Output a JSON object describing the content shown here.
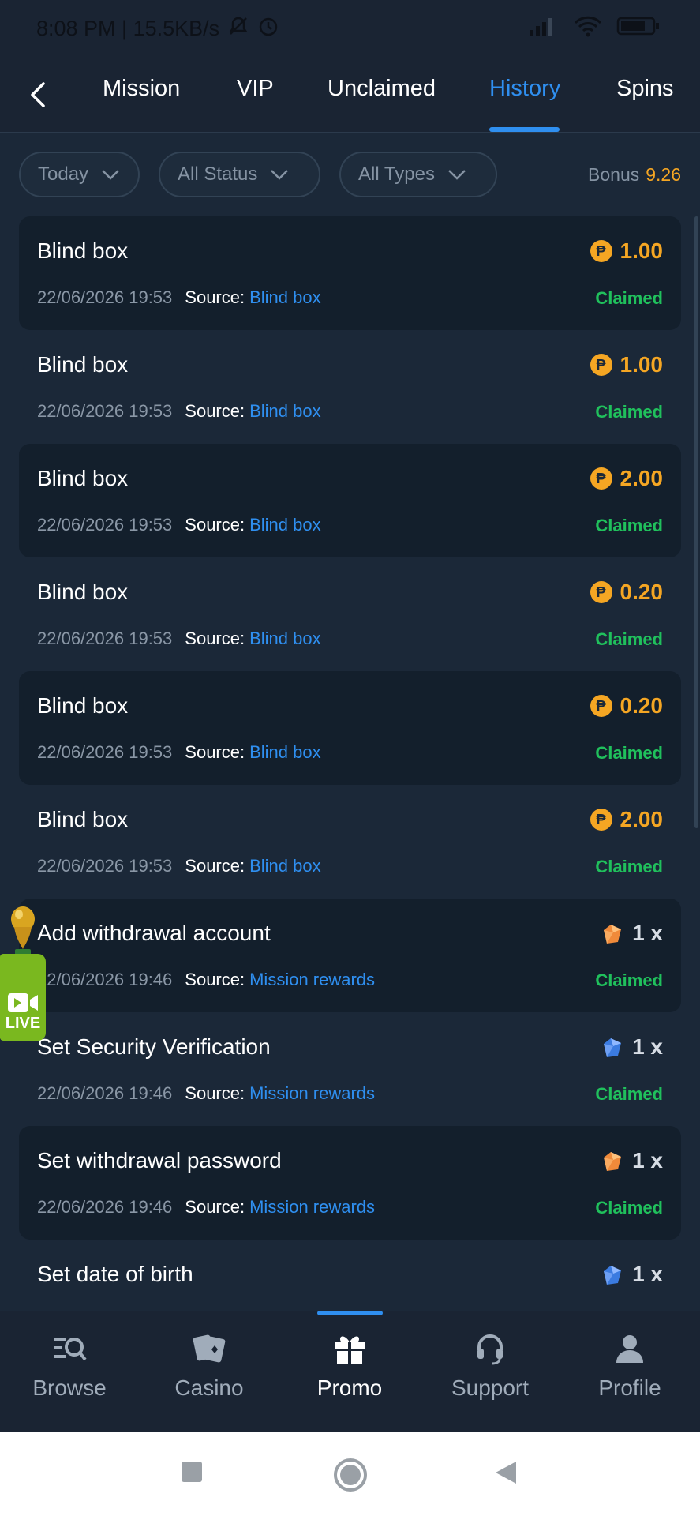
{
  "status_bar": {
    "time_speed": "8:08 PM | 15.5KB/s"
  },
  "tabs": [
    {
      "label": "Mission"
    },
    {
      "label": "VIP"
    },
    {
      "label": "Unclaimed"
    },
    {
      "label": "History",
      "active": true
    },
    {
      "label": "Spins"
    }
  ],
  "filters": {
    "date": "Today",
    "status": "All Status",
    "types": "All Types",
    "bonus_label": "Bonus",
    "bonus_value": "9.26"
  },
  "rows": [
    {
      "title": "Blind box",
      "date": "22/06/2026 19:53",
      "source_label": "Source:",
      "source": "Blind box",
      "amount": "1.00",
      "reward_icon": "coin-icon",
      "status": "Claimed"
    },
    {
      "title": "Blind box",
      "date": "22/06/2026 19:53",
      "source_label": "Source:",
      "source": "Blind box",
      "amount": "1.00",
      "reward_icon": "coin-icon",
      "status": "Claimed"
    },
    {
      "title": "Blind box",
      "date": "22/06/2026 19:53",
      "source_label": "Source:",
      "source": "Blind box",
      "amount": "2.00",
      "reward_icon": "coin-icon",
      "status": "Claimed"
    },
    {
      "title": "Blind box",
      "date": "22/06/2026 19:53",
      "source_label": "Source:",
      "source": "Blind box",
      "amount": "0.20",
      "reward_icon": "coin-icon",
      "status": "Claimed"
    },
    {
      "title": "Blind box",
      "date": "22/06/2026 19:53",
      "source_label": "Source:",
      "source": "Blind box",
      "amount": "0.20",
      "reward_icon": "coin-icon",
      "status": "Claimed"
    },
    {
      "title": "Blind box",
      "date": "22/06/2026 19:53",
      "source_label": "Source:",
      "source": "Blind box",
      "amount": "2.00",
      "reward_icon": "coin-icon",
      "status": "Claimed"
    },
    {
      "title": "Add withdrawal account",
      "date": "22/06/2026 19:46",
      "source_label": "Source:",
      "source": "Mission rewards",
      "amount": "1 x",
      "reward_icon": "orange-gem-icon",
      "status": "Claimed"
    },
    {
      "title": "Set Security Verification",
      "date": "22/06/2026 19:46",
      "source_label": "Source:",
      "source": "Mission rewards",
      "amount": "1 x",
      "reward_icon": "blue-gem-icon",
      "status": "Claimed"
    },
    {
      "title": "Set withdrawal password",
      "date": "22/06/2026 19:46",
      "source_label": "Source:",
      "source": "Mission rewards",
      "amount": "1 x",
      "reward_icon": "orange-gem-icon",
      "status": "Claimed"
    },
    {
      "title": "Set date of birth",
      "date": "",
      "source_label": "",
      "source": "",
      "amount": "1 x",
      "reward_icon": "blue-gem-icon",
      "status": ""
    }
  ],
  "live_badge": {
    "label": "LIVE"
  },
  "bottom_nav": [
    {
      "label": "Browse",
      "icon": "browse-icon"
    },
    {
      "label": "Casino",
      "icon": "cards-icon"
    },
    {
      "label": "Promo",
      "icon": "gift-icon",
      "active": true
    },
    {
      "label": "Support",
      "icon": "headset-icon"
    },
    {
      "label": "Profile",
      "icon": "profile-icon"
    }
  ],
  "colors": {
    "background": "#1b2838",
    "accent_blue": "#2f8ff0",
    "amount_gold": "#f5a623",
    "claimed_green": "#20c05c"
  }
}
